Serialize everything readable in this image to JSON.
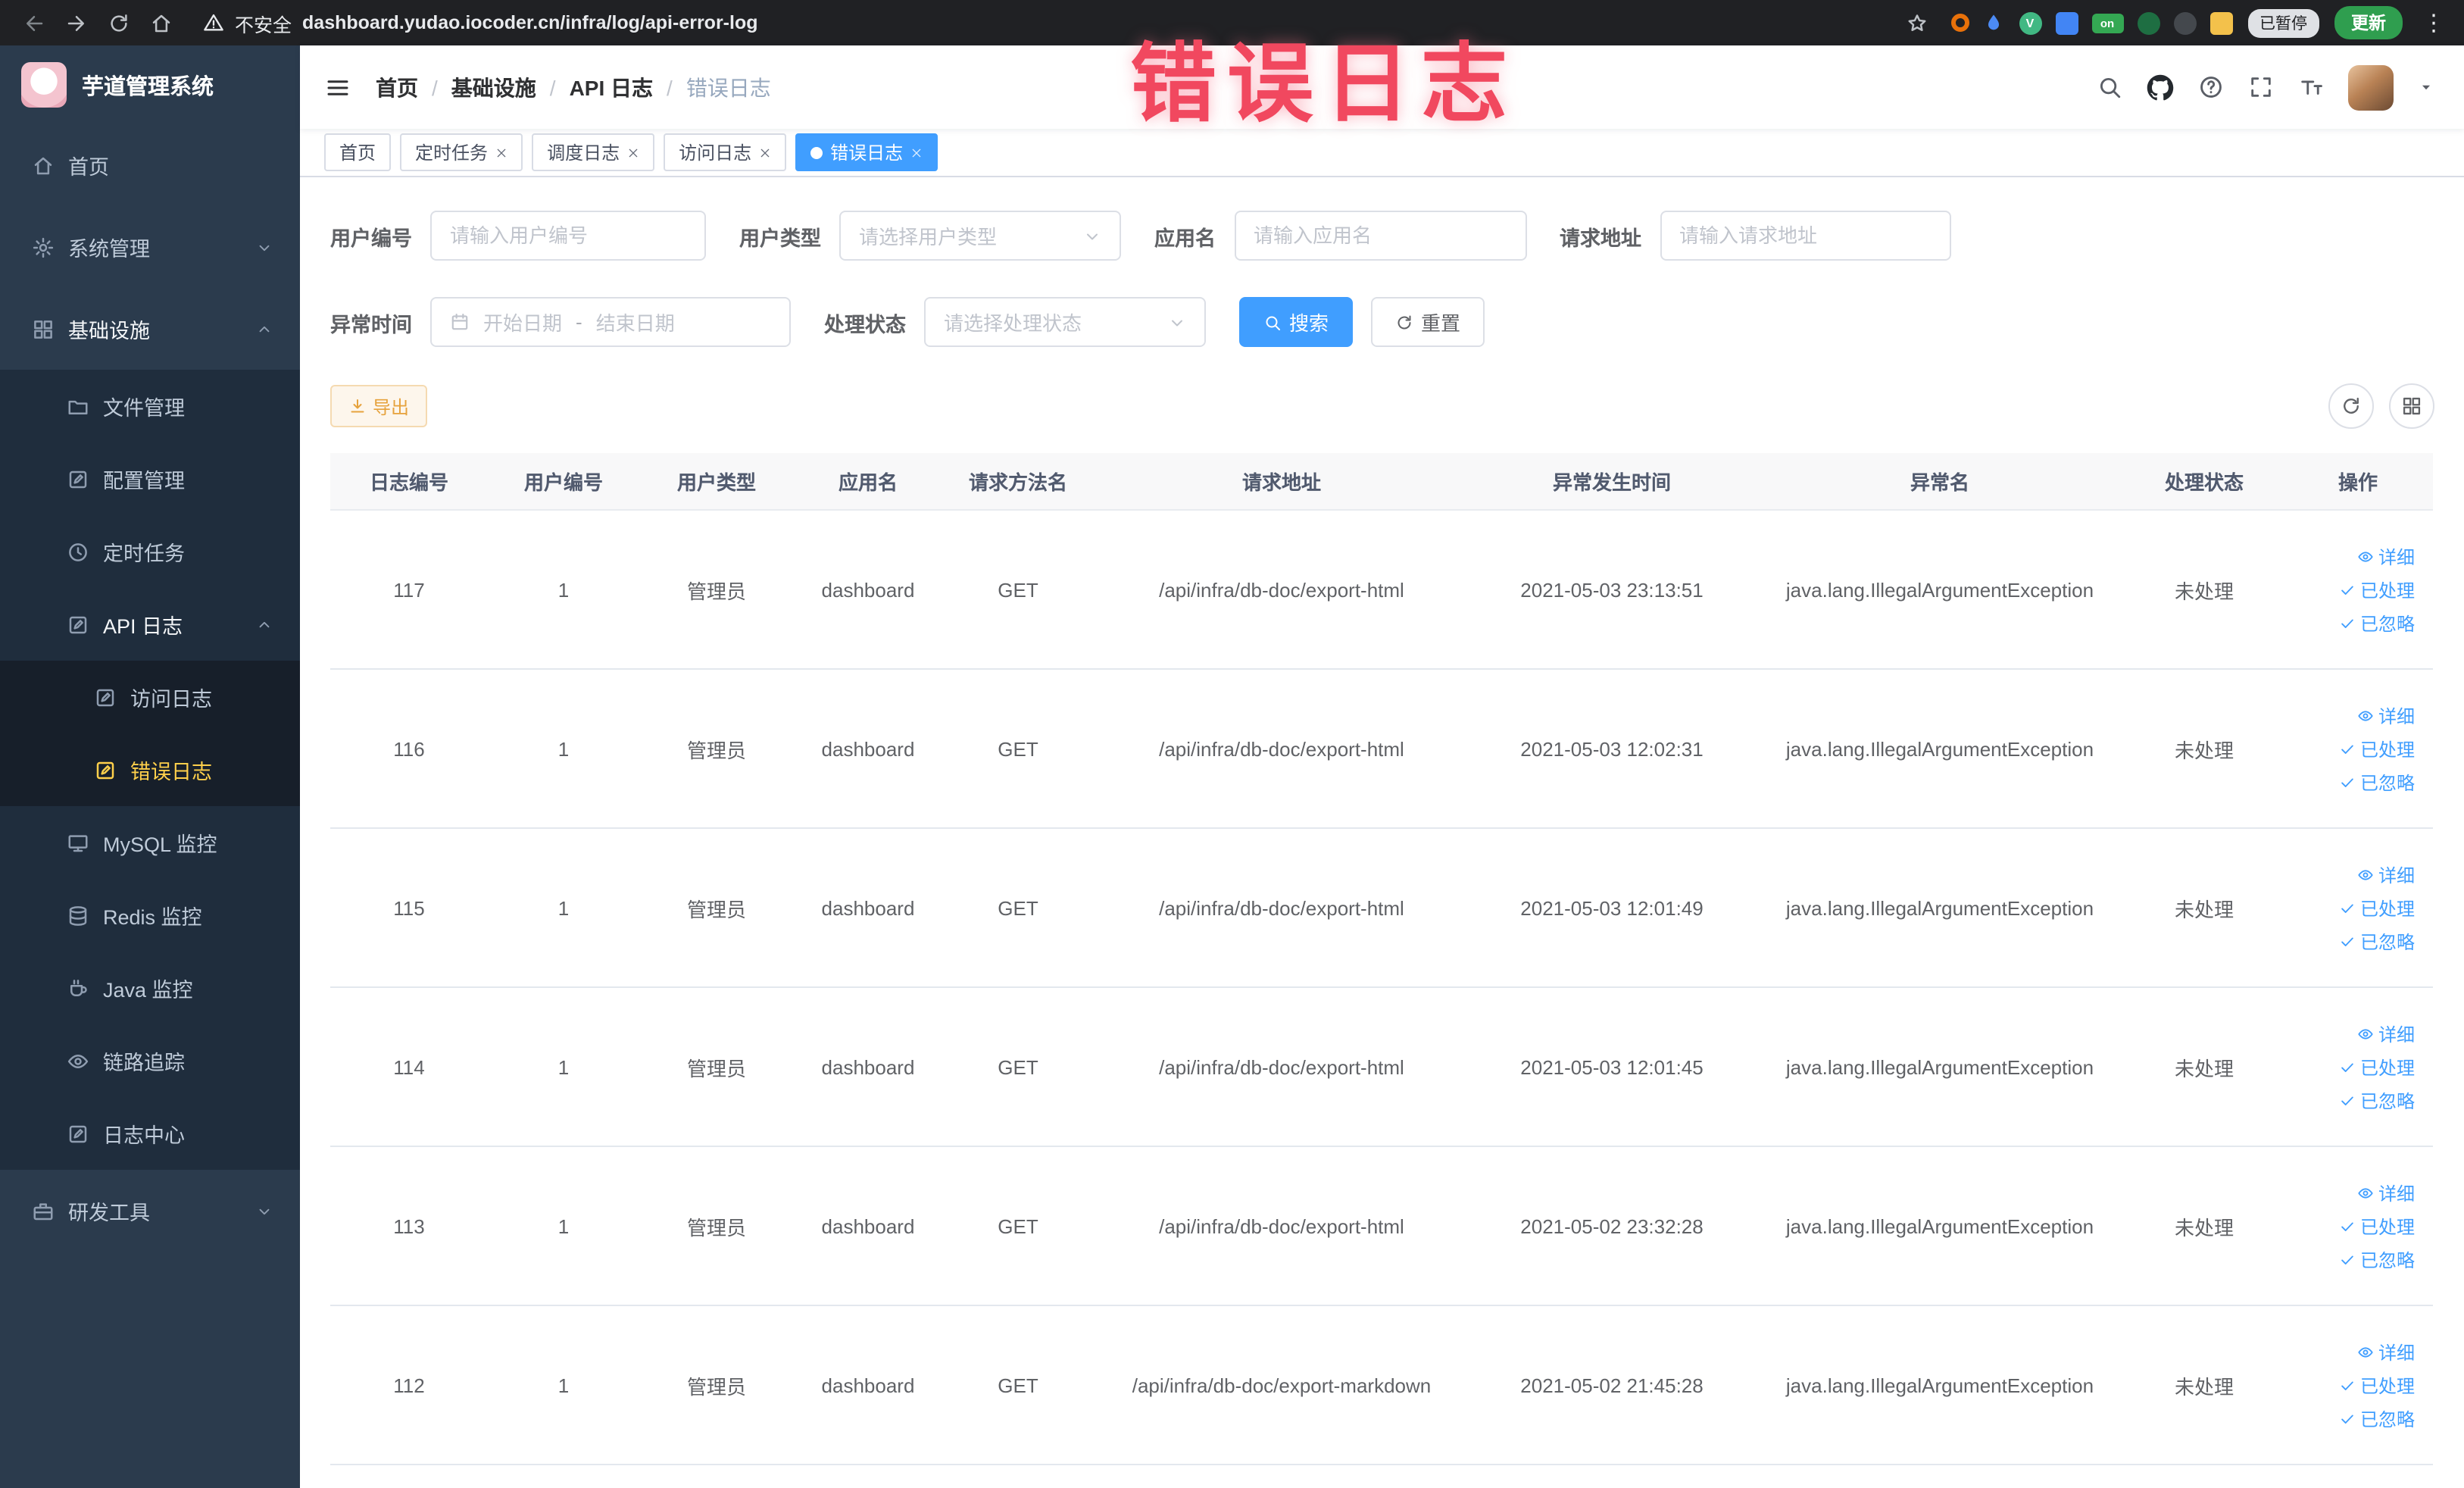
{
  "browser": {
    "security_label": "不安全",
    "url": "dashboard.yudao.iocoder.cn/infra/log/api-error-log",
    "paused_badge": "已暂停",
    "update_button": "更新",
    "menu_dots": "⋮",
    "extensions": [
      {
        "name": "orange-ring-extension-icon",
        "style": "ring",
        "color": "#e8710a",
        "glyph": ""
      },
      {
        "name": "water-drop-extension-icon",
        "style": "drop",
        "color": "#4c8bf5",
        "glyph": ""
      },
      {
        "name": "vue-devtools-extension-icon",
        "style": "circle",
        "color": "#41b883",
        "glyph": "V"
      },
      {
        "name": "blue-grid-extension-icon",
        "style": "square",
        "color": "#4285f4",
        "glyph": ""
      },
      {
        "name": "on-switch-extension-icon",
        "style": "pill",
        "color": "#34a853",
        "glyph": "on"
      },
      {
        "name": "green-leaf-extension-icon",
        "style": "circle",
        "color": "#1e6e42",
        "glyph": ""
      },
      {
        "name": "dark-paw-extension-icon",
        "style": "circle",
        "color": "#44484d",
        "glyph": ""
      },
      {
        "name": "tampermonkey-extension-icon",
        "style": "square",
        "color": "#f3c14b",
        "glyph": ""
      }
    ]
  },
  "annotation": {
    "text": "错误日志"
  },
  "sidebar": {
    "logo_title": "芋道管理系统",
    "items": [
      {
        "key": "home",
        "label": "首页",
        "icon": "home",
        "level": 1
      },
      {
        "key": "system",
        "label": "系统管理",
        "icon": "gear",
        "level": 1,
        "expandable": true,
        "expanded": false
      },
      {
        "key": "infra",
        "label": "基础设施",
        "icon": "grid",
        "level": 1,
        "expandable": true,
        "expanded": true
      },
      {
        "key": "file",
        "label": "文件管理",
        "icon": "folder",
        "level": 2
      },
      {
        "key": "config",
        "label": "配置管理",
        "icon": "doc-edit",
        "level": 2
      },
      {
        "key": "job",
        "label": "定时任务",
        "icon": "clock",
        "level": 2
      },
      {
        "key": "api-log",
        "label": "API 日志",
        "icon": "doc-edit",
        "level": 2,
        "expandable": true,
        "expanded": true
      },
      {
        "key": "access-log",
        "label": "访问日志",
        "icon": "doc-edit",
        "level": 3
      },
      {
        "key": "error-log",
        "label": "错误日志",
        "icon": "doc-edit",
        "level": 3,
        "active": true
      },
      {
        "key": "mysql",
        "label": "MySQL 监控",
        "icon": "monitor",
        "level": 2
      },
      {
        "key": "redis",
        "label": "Redis 监控",
        "icon": "database",
        "level": 2
      },
      {
        "key": "java",
        "label": "Java 监控",
        "icon": "coffee",
        "level": 2
      },
      {
        "key": "trace",
        "label": "链路追踪",
        "icon": "eye",
        "level": 2
      },
      {
        "key": "log-center",
        "label": "日志中心",
        "icon": "doc-edit",
        "level": 2
      },
      {
        "key": "dev-tools",
        "label": "研发工具",
        "icon": "briefcase",
        "level": 1,
        "expandable": true,
        "expanded": false
      }
    ]
  },
  "header": {
    "breadcrumb": [
      "首页",
      "基础设施",
      "API 日志",
      "错误日志"
    ],
    "separator": "/"
  },
  "tabs": [
    {
      "key": "home",
      "label": "首页",
      "closable": false,
      "active": false
    },
    {
      "key": "job",
      "label": "定时任务",
      "closable": true,
      "active": false
    },
    {
      "key": "job-log",
      "label": "调度日志",
      "closable": true,
      "active": false
    },
    {
      "key": "access-log",
      "label": "访问日志",
      "closable": true,
      "active": false
    },
    {
      "key": "error-log",
      "label": "错误日志",
      "closable": true,
      "active": true
    }
  ],
  "filters": {
    "user_id_label": "用户编号",
    "user_id_placeholder": "请输入用户编号",
    "user_type_label": "用户类型",
    "user_type_placeholder": "请选择用户类型",
    "app_name_label": "应用名",
    "app_name_placeholder": "请输入应用名",
    "request_url_label": "请求地址",
    "request_url_placeholder": "请输入请求地址",
    "exception_time_label": "异常时间",
    "start_date_placeholder": "开始日期",
    "range_separator": "-",
    "end_date_placeholder": "结束日期",
    "process_status_label": "处理状态",
    "process_status_placeholder": "请选择处理状态",
    "search_button": "搜索",
    "reset_button": "重置"
  },
  "toolbar": {
    "export_button": "导出"
  },
  "table": {
    "columns": [
      "日志编号",
      "用户编号",
      "用户类型",
      "应用名",
      "请求方法名",
      "请求地址",
      "异常发生时间",
      "异常名",
      "处理状态",
      "操作"
    ],
    "fields": [
      "id",
      "user_id",
      "user_type",
      "app",
      "method",
      "url",
      "time",
      "exception",
      "status"
    ],
    "rows": [
      {
        "id": "117",
        "user_id": "1",
        "user_type": "管理员",
        "app": "dashboard",
        "method": "GET",
        "url": "/api/infra/db-doc/export-html",
        "time": "2021-05-03 23:13:51",
        "exception": "java.lang.IllegalArgumentException",
        "status": "未处理"
      },
      {
        "id": "116",
        "user_id": "1",
        "user_type": "管理员",
        "app": "dashboard",
        "method": "GET",
        "url": "/api/infra/db-doc/export-html",
        "time": "2021-05-03 12:02:31",
        "exception": "java.lang.IllegalArgumentException",
        "status": "未处理"
      },
      {
        "id": "115",
        "user_id": "1",
        "user_type": "管理员",
        "app": "dashboard",
        "method": "GET",
        "url": "/api/infra/db-doc/export-html",
        "time": "2021-05-03 12:01:49",
        "exception": "java.lang.IllegalArgumentException",
        "status": "未处理"
      },
      {
        "id": "114",
        "user_id": "1",
        "user_type": "管理员",
        "app": "dashboard",
        "method": "GET",
        "url": "/api/infra/db-doc/export-html",
        "time": "2021-05-03 12:01:45",
        "exception": "java.lang.IllegalArgumentException",
        "status": "未处理"
      },
      {
        "id": "113",
        "user_id": "1",
        "user_type": "管理员",
        "app": "dashboard",
        "method": "GET",
        "url": "/api/infra/db-doc/export-html",
        "time": "2021-05-02 23:32:28",
        "exception": "java.lang.IllegalArgumentException",
        "status": "未处理"
      },
      {
        "id": "112",
        "user_id": "1",
        "user_type": "管理员",
        "app": "dashboard",
        "method": "GET",
        "url": "/api/infra/db-doc/export-markdown",
        "time": "2021-05-02 21:45:28",
        "exception": "java.lang.IllegalArgumentException",
        "status": "未处理"
      }
    ],
    "actions": [
      {
        "key": "detail",
        "label": "详细",
        "icon": "eye"
      },
      {
        "key": "processed",
        "label": "已处理",
        "icon": "check"
      },
      {
        "key": "ignored",
        "label": "已忽略",
        "icon": "check"
      }
    ]
  },
  "colors": {
    "accent": "#409eff",
    "active_menu": "#ffd04b",
    "warning_button": "#e6a23c",
    "annotation": "#f1485f",
    "sidebar_bg": "#2b3b4d",
    "submenu_bg": "#1f2d3d"
  }
}
